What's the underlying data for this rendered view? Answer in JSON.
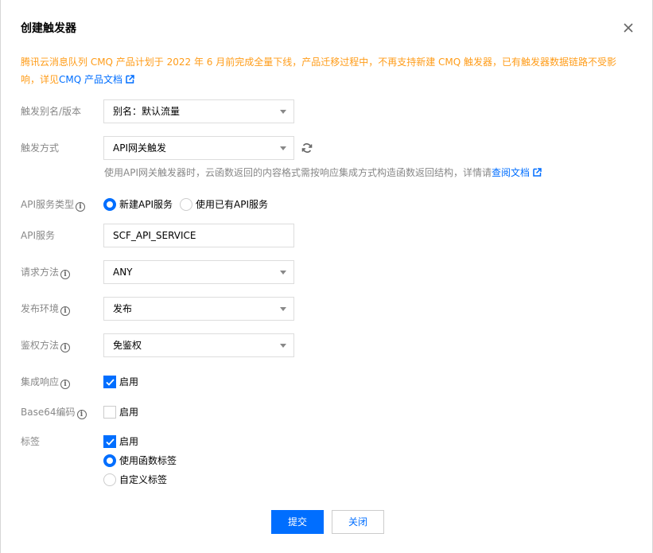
{
  "dialog": {
    "title": "创建触发器",
    "close_icon": "close-icon"
  },
  "notice": {
    "text": "腾讯云消息队列 CMQ 产品计划于 2022 年 6 月前完成全量下线，产品迁移过程中，不再支持新建 CMQ 触发器，已有触发器数据链路不受影响，详见",
    "link": "CMQ 产品文档",
    "color": "#ff9c19"
  },
  "form": {
    "alias": {
      "label": "触发别名/版本",
      "value": "别名：默认流量"
    },
    "trigger_type": {
      "label": "触发方式",
      "value": "API网关触发"
    },
    "hint": {
      "text": "使用API网关触发器时，云函数返回的内容格式需按响应集成方式构造函数返回结构，详情请",
      "link": "查阅文档"
    },
    "api_service_type": {
      "label": "API服务类型",
      "options": [
        "新建API服务",
        "使用已有API服务"
      ],
      "selected": "新建API服务"
    },
    "api_service": {
      "label": "API服务",
      "value": "SCF_API_SERVICE"
    },
    "request_method": {
      "label": "请求方法",
      "value": "ANY"
    },
    "env": {
      "label": "发布环境",
      "value": "发布"
    },
    "auth": {
      "label": "鉴权方法",
      "value": "免鉴权"
    },
    "integration": {
      "label": "集成响应",
      "check_label": "启用",
      "checked": true
    },
    "base64": {
      "label": "Base64编码",
      "check_label": "启用",
      "checked": false
    },
    "tags": {
      "label": "标签",
      "check_label": "启用",
      "checked": true,
      "options": [
        "使用函数标签",
        "自定义标签"
      ],
      "selected": "使用函数标签"
    }
  },
  "footer": {
    "submit": "提交",
    "close": "关闭"
  },
  "colors": {
    "accent": "#006eff",
    "warning": "#ff9c19",
    "label": "#888888"
  }
}
